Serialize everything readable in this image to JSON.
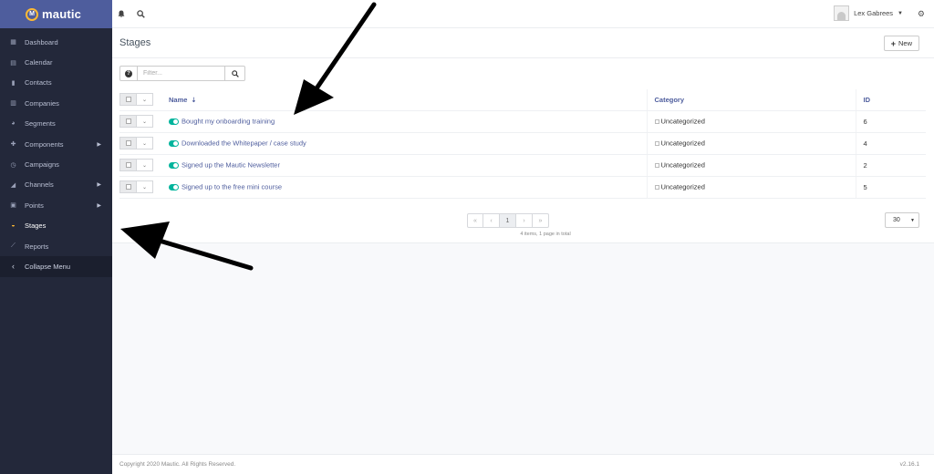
{
  "brand": {
    "name": "mautic",
    "logo_letter": "M",
    "accent": "#fdb933",
    "bar_color": "#4e5d9d"
  },
  "sidebar": {
    "items": [
      {
        "label": "Dashboard",
        "icon": "grid-icon",
        "glyph": "▦"
      },
      {
        "label": "Calendar",
        "icon": "calendar-icon",
        "glyph": "▤"
      },
      {
        "label": "Contacts",
        "icon": "contact-icon",
        "glyph": "▮"
      },
      {
        "label": "Companies",
        "icon": "building-icon",
        "glyph": "▥"
      },
      {
        "label": "Segments",
        "icon": "pie-chart-icon",
        "glyph": "◕"
      },
      {
        "label": "Components",
        "icon": "puzzle-icon",
        "glyph": "✚"
      },
      {
        "label": "Campaigns",
        "icon": "clock-icon",
        "glyph": "◷"
      },
      {
        "label": "Channels",
        "icon": "rss-icon",
        "glyph": "◢"
      },
      {
        "label": "Points",
        "icon": "calculator-icon",
        "glyph": "▣"
      },
      {
        "label": "Stages",
        "icon": "tachometer-icon",
        "glyph": "◒"
      },
      {
        "label": "Reports",
        "icon": "line-chart-icon",
        "glyph": "⟋"
      }
    ],
    "collapse_label": "Collapse Menu",
    "collapse_glyph": "‹"
  },
  "topbar": {
    "user_name": "Lex Gabrees",
    "dropdown_glyph": "▼",
    "gear_glyph": "⚙",
    "bell_glyph": "🔔",
    "search_glyph": "⚲"
  },
  "page": {
    "title": "Stages",
    "new_button": "New",
    "new_glyph": "+"
  },
  "filter": {
    "placeholder": "Filter...",
    "help_glyph": "?",
    "search_glyph": "⚲"
  },
  "table": {
    "headers": {
      "name": "Name",
      "category": "Category",
      "id": "ID",
      "sort_glyph": "⇣"
    },
    "rows": [
      {
        "name": "Bought my onboarding training",
        "category": "Uncategorized",
        "id": "6"
      },
      {
        "name": "Downloaded the Whitepaper / case study",
        "category": "Uncategorized",
        "id": "4"
      },
      {
        "name": "Signed up the Mautic Newsletter",
        "category": "Uncategorized",
        "id": "2"
      },
      {
        "name": "Signed up to the free mini course",
        "category": "Uncategorized",
        "id": "5"
      }
    ],
    "dropdown_glyph": "⌄"
  },
  "pagination": {
    "first": "«",
    "prev": "‹",
    "current": "1",
    "next": "›",
    "last": "»",
    "info": "4 items, 1 page in total",
    "limit": "30",
    "limit_caret": "▼"
  },
  "footer": {
    "copyright": "Copyright 2020 Mautic. All Rights Reserved.",
    "version": "v2.16.1"
  }
}
